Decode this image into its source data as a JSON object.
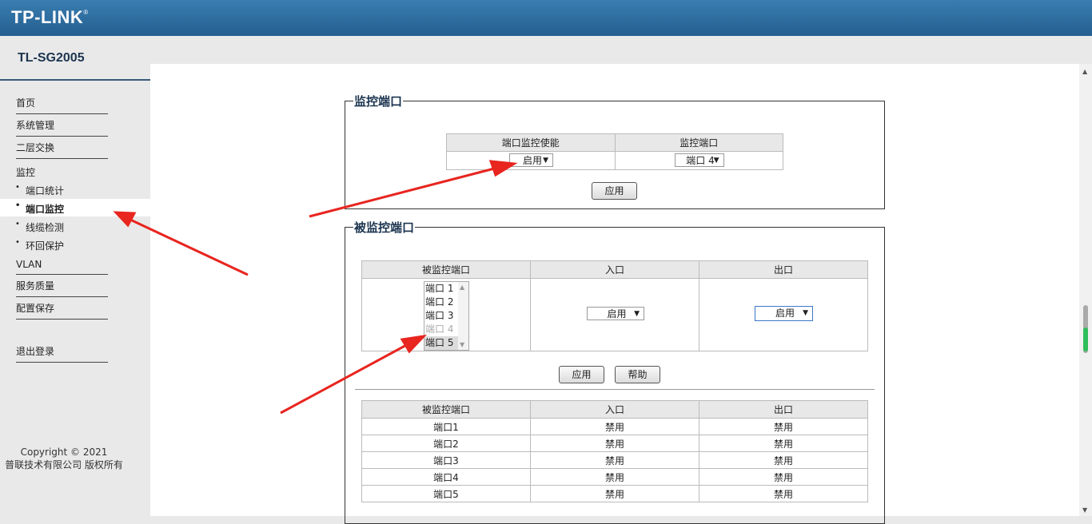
{
  "header": {
    "brand": "TP-LINK",
    "registered": "®",
    "model": "TL-SG2005"
  },
  "sidebar": {
    "items": [
      {
        "label": "首页"
      },
      {
        "label": "系统管理"
      },
      {
        "label": "二层交换"
      },
      {
        "label": "监控"
      }
    ],
    "sub_items": [
      {
        "label": "端口统计"
      },
      {
        "label": "端口监控"
      },
      {
        "label": "线缆检测"
      },
      {
        "label": "环回保护"
      }
    ],
    "items_after": [
      {
        "label": "VLAN"
      },
      {
        "label": "服务质量"
      },
      {
        "label": "配置保存"
      }
    ],
    "logout": "退出登录",
    "bullet": "•",
    "copyright_line1": "Copyright © 2021",
    "copyright_line2": "普联技术有限公司 版权所有"
  },
  "monitor_port": {
    "legend": "监控端口",
    "col_enable": "端口监控使能",
    "col_port": "监控端口",
    "enable_value": "启用",
    "port_value": "端口 4",
    "apply_label": "应用"
  },
  "monitored_ports": {
    "legend": "被监控端口",
    "col_port": "被监控端口",
    "col_ingress": "入口",
    "col_egress": "出口",
    "port_options": [
      "端口 1",
      "端口 2",
      "端口 3",
      "端口 4",
      "端口 5"
    ],
    "ingress_value": "启用",
    "egress_value": "启用",
    "apply_label": "应用",
    "help_label": "帮助"
  },
  "status_table": {
    "headers": [
      "被监控端口",
      "入口",
      "出口"
    ],
    "rows": [
      [
        "端口1",
        "禁用",
        "禁用"
      ],
      [
        "端口2",
        "禁用",
        "禁用"
      ],
      [
        "端口3",
        "禁用",
        "禁用"
      ],
      [
        "端口4",
        "禁用",
        "禁用"
      ],
      [
        "端口5",
        "禁用",
        "禁用"
      ]
    ]
  },
  "colors": {
    "header_bg": "#245f90",
    "arrow": "#e8251f",
    "legend_text": "#1c3550"
  },
  "icons": {
    "dropdown": "▼",
    "scroll_up": "▲",
    "scroll_down": "▼"
  }
}
